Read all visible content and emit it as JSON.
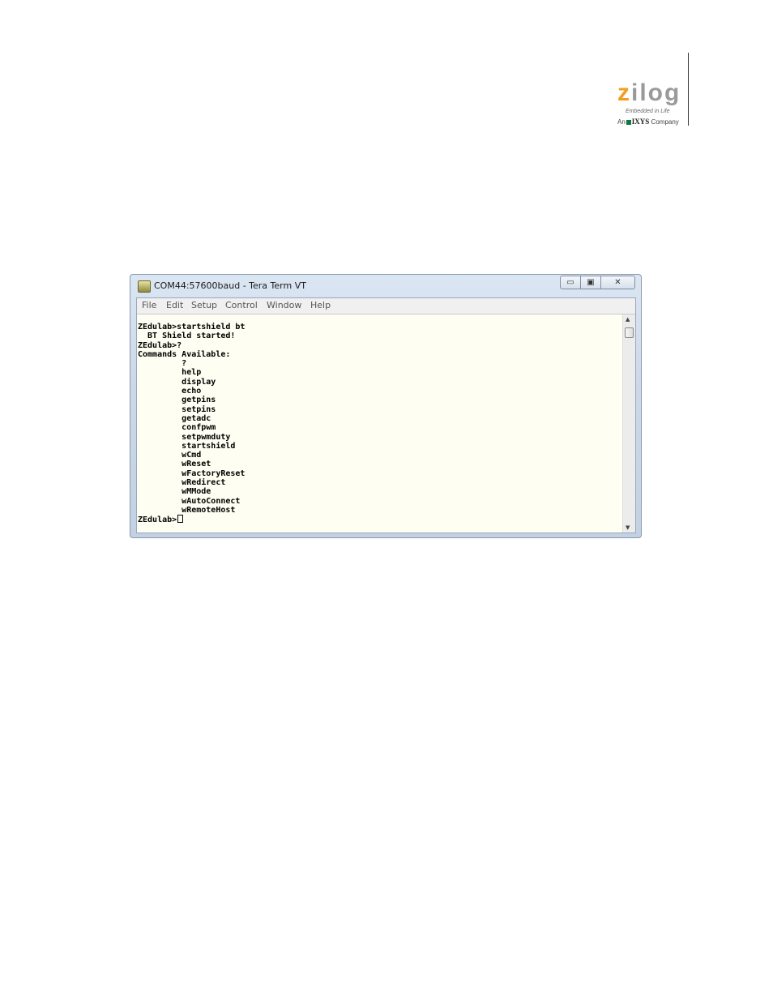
{
  "logo": {
    "word": "zilog",
    "tagline": "Embedded in Life",
    "company_prefix": "An",
    "company_name": "IXYS",
    "company_suffix": "Company",
    "brand_color": "#f0a020"
  },
  "window": {
    "title": "COM44:57600baud - Tera Term VT",
    "icon": "tera-term-app-icon",
    "controls": {
      "minimize": "▭",
      "maximize": "▣",
      "close": "✕"
    }
  },
  "menu": [
    "File",
    "Edit",
    "Setup",
    "Control",
    "Window",
    "Help"
  ],
  "terminal": {
    "lines": [
      "ZEdulab>startshield bt",
      "  BT Shield started!",
      "ZEdulab>?",
      "Commands Available:",
      "         ?",
      "         help",
      "         display",
      "         echo",
      "         getpins",
      "         setpins",
      "         getadc",
      "         confpwm",
      "         setpwmduty",
      "         startshield",
      "         wCmd",
      "         wReset",
      "         wFactoryReset",
      "         wRedirect",
      "         wMMode",
      "         wAutoConnect",
      "         wRemoteHost"
    ],
    "prompt": "ZEdulab>"
  },
  "scrollbar": {
    "up": "▲",
    "down": "▼",
    "position": 0
  }
}
